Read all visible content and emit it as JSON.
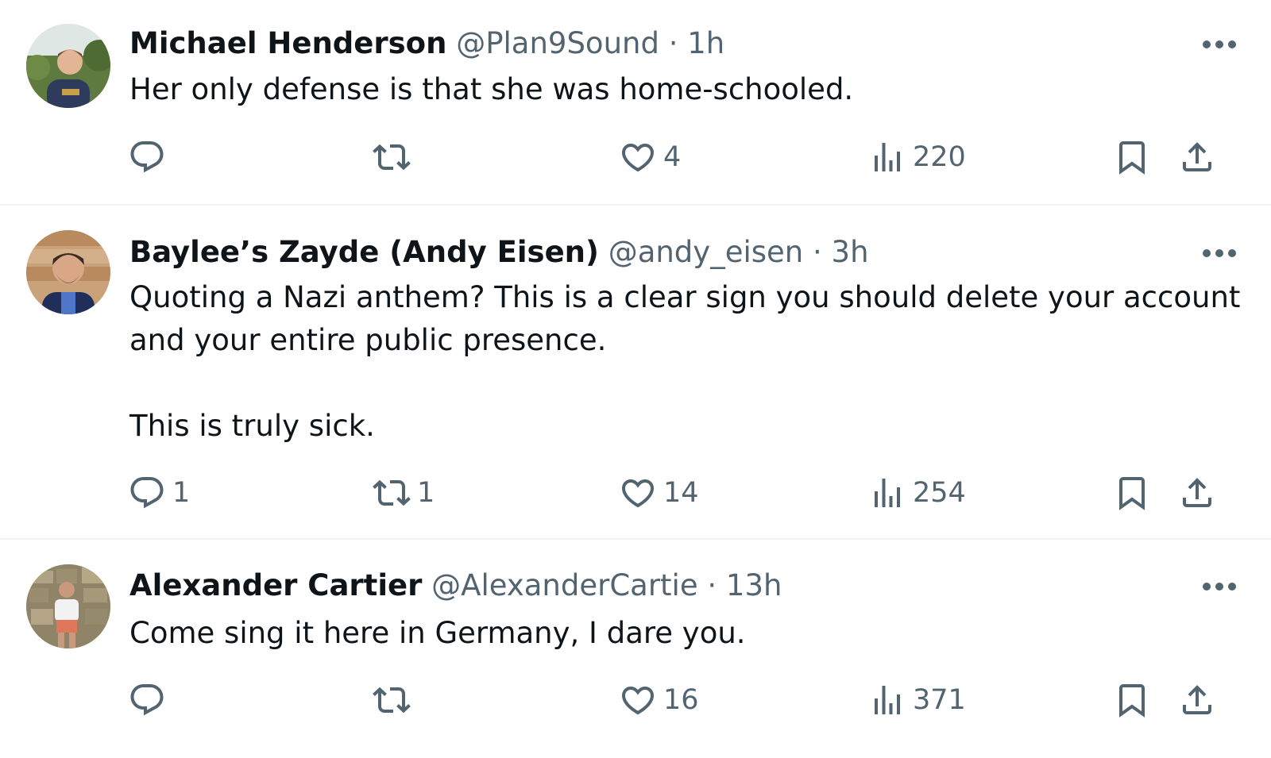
{
  "tweets": [
    {
      "name": "Michael Henderson",
      "handle": "@Plan9Sound",
      "separator": "·",
      "time": "1h",
      "text": "Her only defense is that she was home-schooled.",
      "replies": "",
      "reposts": "",
      "likes": "4",
      "views": "220",
      "avatar_icon": "avatar-photo-man-outdoors"
    },
    {
      "name": "Baylee’s Zayde (Andy Eisen)",
      "handle": "@andy_eisen",
      "separator": "·",
      "time": "3h",
      "text": "Quoting a Nazi anthem? This is a clear sign you should delete your account and your entire public presence.\n\nThis is truly sick.",
      "replies": "1",
      "reposts": "1",
      "likes": "14",
      "views": "254",
      "avatar_icon": "avatar-photo-man-beard"
    },
    {
      "name": "Alexander Cartier",
      "handle": "@AlexanderCartie",
      "separator": "·",
      "time": "13h",
      "text": "Come sing it here in Germany, I dare you.",
      "replies": "",
      "reposts": "",
      "likes": "16",
      "views": "371",
      "avatar_icon": "avatar-photo-man-wall"
    }
  ],
  "icons": {
    "more": "more-dots-icon",
    "reply": "reply-icon",
    "repost": "repost-icon",
    "like": "like-heart-icon",
    "views": "views-bar-chart-icon",
    "bookmark": "bookmark-icon",
    "share": "share-upload-icon"
  },
  "colors": {
    "text": "#0f1419",
    "secondary": "#536471",
    "divider": "#eff3f4"
  }
}
